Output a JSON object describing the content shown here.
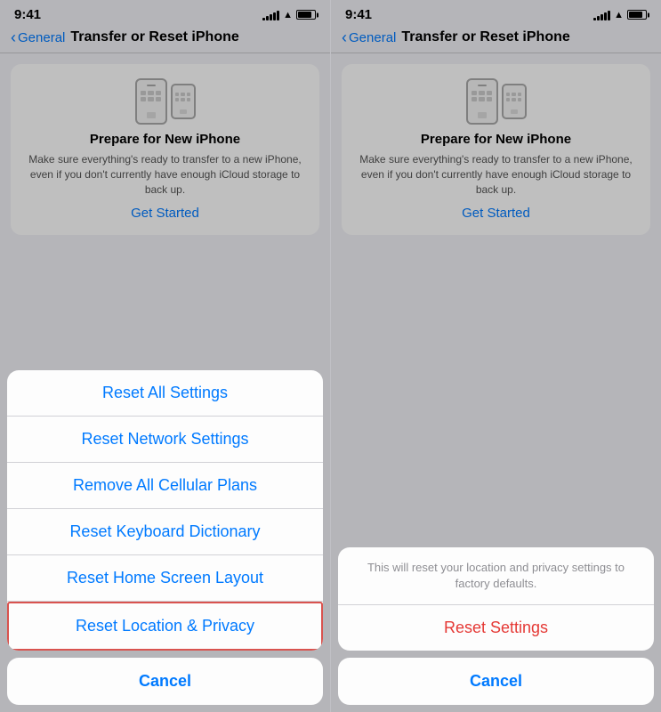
{
  "panels": [
    {
      "id": "left",
      "status": {
        "time": "9:41",
        "signal_bars": [
          3,
          5,
          7,
          9,
          11
        ],
        "wifi": "wifi",
        "battery": "battery"
      },
      "nav": {
        "back_label": "General",
        "title": "Transfer or Reset iPhone"
      },
      "prepare_card": {
        "title": "Prepare for New iPhone",
        "description": "Make sure everything's ready to transfer to a new iPhone, even if you don't currently have enough iCloud storage to back up.",
        "cta": "Get Started"
      },
      "action_sheet": {
        "items": [
          "Reset All Settings",
          "Reset Network Settings",
          "Remove All Cellular Plans",
          "Reset Keyboard Dictionary",
          "Reset Home Screen Layout",
          "Reset Location & Privacy"
        ],
        "highlighted_index": 5,
        "cancel": "Cancel"
      }
    },
    {
      "id": "right",
      "status": {
        "time": "9:41",
        "signal_bars": [
          3,
          5,
          7,
          9,
          11
        ],
        "wifi": "wifi",
        "battery": "battery"
      },
      "nav": {
        "back_label": "General",
        "title": "Transfer or Reset iPhone"
      },
      "prepare_card": {
        "title": "Prepare for New iPhone",
        "description": "Make sure everything's ready to transfer to a new iPhone, even if you don't currently have enough iCloud storage to back up.",
        "cta": "Get Started"
      },
      "confirm_sheet": {
        "message": "This will reset your location and privacy settings to factory defaults.",
        "reset_btn": "Reset Settings",
        "cancel": "Cancel"
      }
    }
  ]
}
